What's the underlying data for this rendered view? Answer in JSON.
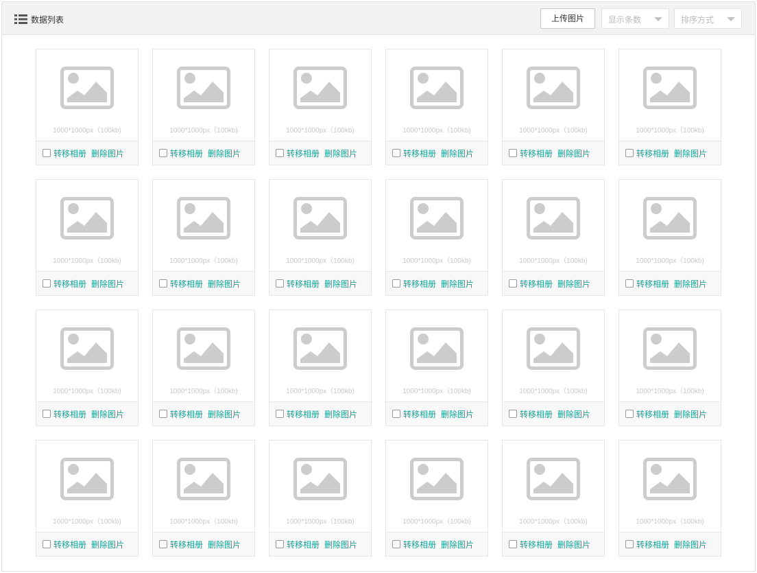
{
  "header": {
    "title": "数据列表",
    "upload_label": "上传图片",
    "count_select": {
      "placeholder": "显示条数"
    },
    "sort_select": {
      "placeholder": "排序方式"
    }
  },
  "colors": {
    "link": "#1aa094",
    "placeholder_icon": "#cccccc"
  },
  "icons": {
    "header": "list-icon",
    "card": "image-placeholder-icon"
  },
  "cards": [
    {
      "size": "1000*1000px（100kb)",
      "move_label": "转移相册",
      "delete_label": "删除图片"
    },
    {
      "size": "1000*1000px（100kb)",
      "move_label": "转移相册",
      "delete_label": "删除图片"
    },
    {
      "size": "1000*1000px（100kb)",
      "move_label": "转移相册",
      "delete_label": "删除图片"
    },
    {
      "size": "1000*1000px（100kb)",
      "move_label": "转移相册",
      "delete_label": "删除图片"
    },
    {
      "size": "1000*1000px（100kb)",
      "move_label": "转移相册",
      "delete_label": "删除图片"
    },
    {
      "size": "1000*1000px（100kb)",
      "move_label": "转移相册",
      "delete_label": "删除图片"
    },
    {
      "size": "1000*1000px（100kb)",
      "move_label": "转移相册",
      "delete_label": "删除图片"
    },
    {
      "size": "1000*1000px（100kb)",
      "move_label": "转移相册",
      "delete_label": "删除图片"
    },
    {
      "size": "1000*1000px（100kb)",
      "move_label": "转移相册",
      "delete_label": "删除图片"
    },
    {
      "size": "1000*1000px（100kb)",
      "move_label": "转移相册",
      "delete_label": "删除图片"
    },
    {
      "size": "1000*1000px（100kb)",
      "move_label": "转移相册",
      "delete_label": "删除图片"
    },
    {
      "size": "1000*1000px（100kb)",
      "move_label": "转移相册",
      "delete_label": "删除图片"
    },
    {
      "size": "1000*1000px（100kb)",
      "move_label": "转移相册",
      "delete_label": "删除图片"
    },
    {
      "size": "1000*1000px（100kb)",
      "move_label": "转移相册",
      "delete_label": "删除图片"
    },
    {
      "size": "1000*1000px（100kb)",
      "move_label": "转移相册",
      "delete_label": "删除图片"
    },
    {
      "size": "1000*1000px（100kb)",
      "move_label": "转移相册",
      "delete_label": "删除图片"
    },
    {
      "size": "1000*1000px（100kb)",
      "move_label": "转移相册",
      "delete_label": "删除图片"
    },
    {
      "size": "1000*1000px（100kb)",
      "move_label": "转移相册",
      "delete_label": "删除图片"
    },
    {
      "size": "1000*1000px（100kb)",
      "move_label": "转移相册",
      "delete_label": "删除图片"
    },
    {
      "size": "1000*1000px（100kb)",
      "move_label": "转移相册",
      "delete_label": "删除图片"
    },
    {
      "size": "1000*1000px（100kb)",
      "move_label": "转移相册",
      "delete_label": "删除图片"
    },
    {
      "size": "1000*1000px（100kb)",
      "move_label": "转移相册",
      "delete_label": "删除图片"
    },
    {
      "size": "1000*1000px（100kb)",
      "move_label": "转移相册",
      "delete_label": "删除图片"
    },
    {
      "size": "1000*1000px（100kb)",
      "move_label": "转移相册",
      "delete_label": "删除图片"
    }
  ]
}
